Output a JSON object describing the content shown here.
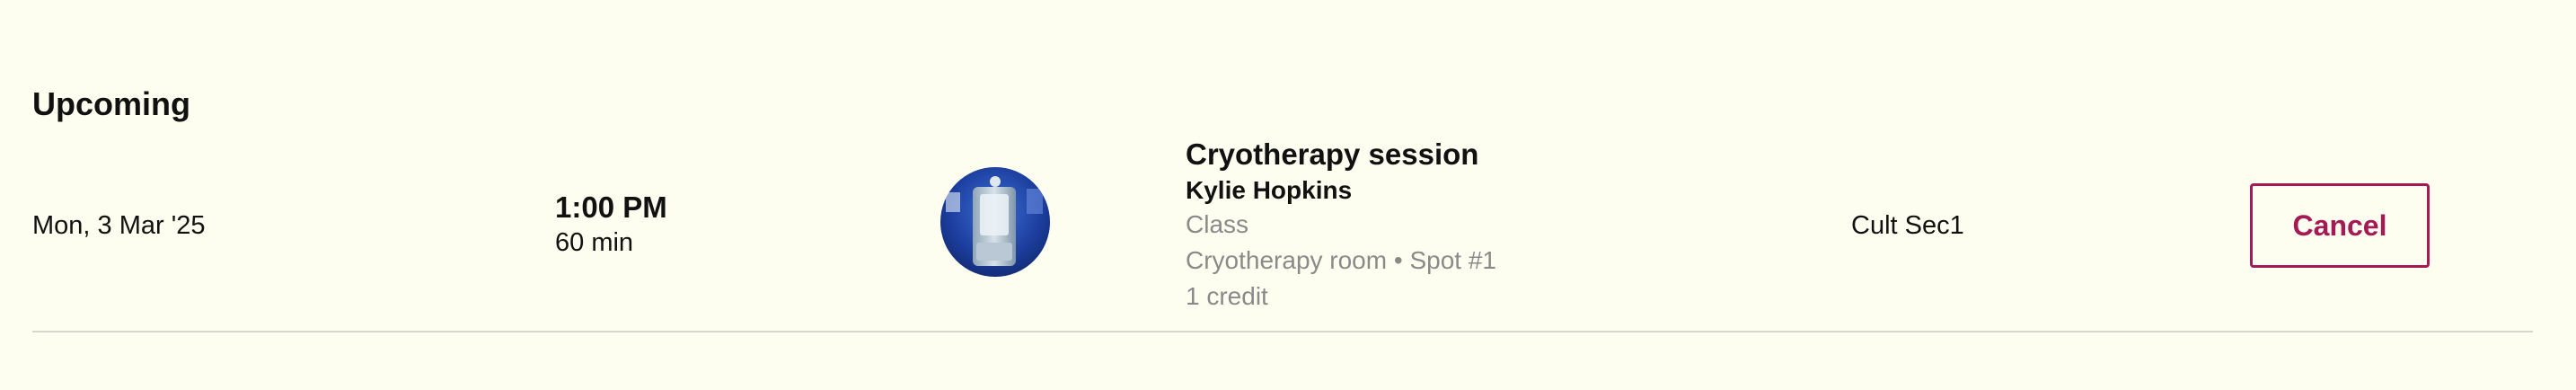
{
  "section": {
    "title": "Upcoming"
  },
  "booking": {
    "date": "Mon, 3 Mar '25",
    "time": "1:00 PM",
    "duration": "60 min",
    "class_name": "Cryotherapy session",
    "instructor": "Kylie Hopkins",
    "type": "Class",
    "room_spot": "Cryotherapy room • Spot #1",
    "credits": "1 credit",
    "location": "Cult Sec1",
    "cancel_label": "Cancel"
  },
  "colors": {
    "background": "#fefef0",
    "accent": "#a31a55",
    "muted_text": "#8a8a8a",
    "divider": "#d6d6cc"
  }
}
